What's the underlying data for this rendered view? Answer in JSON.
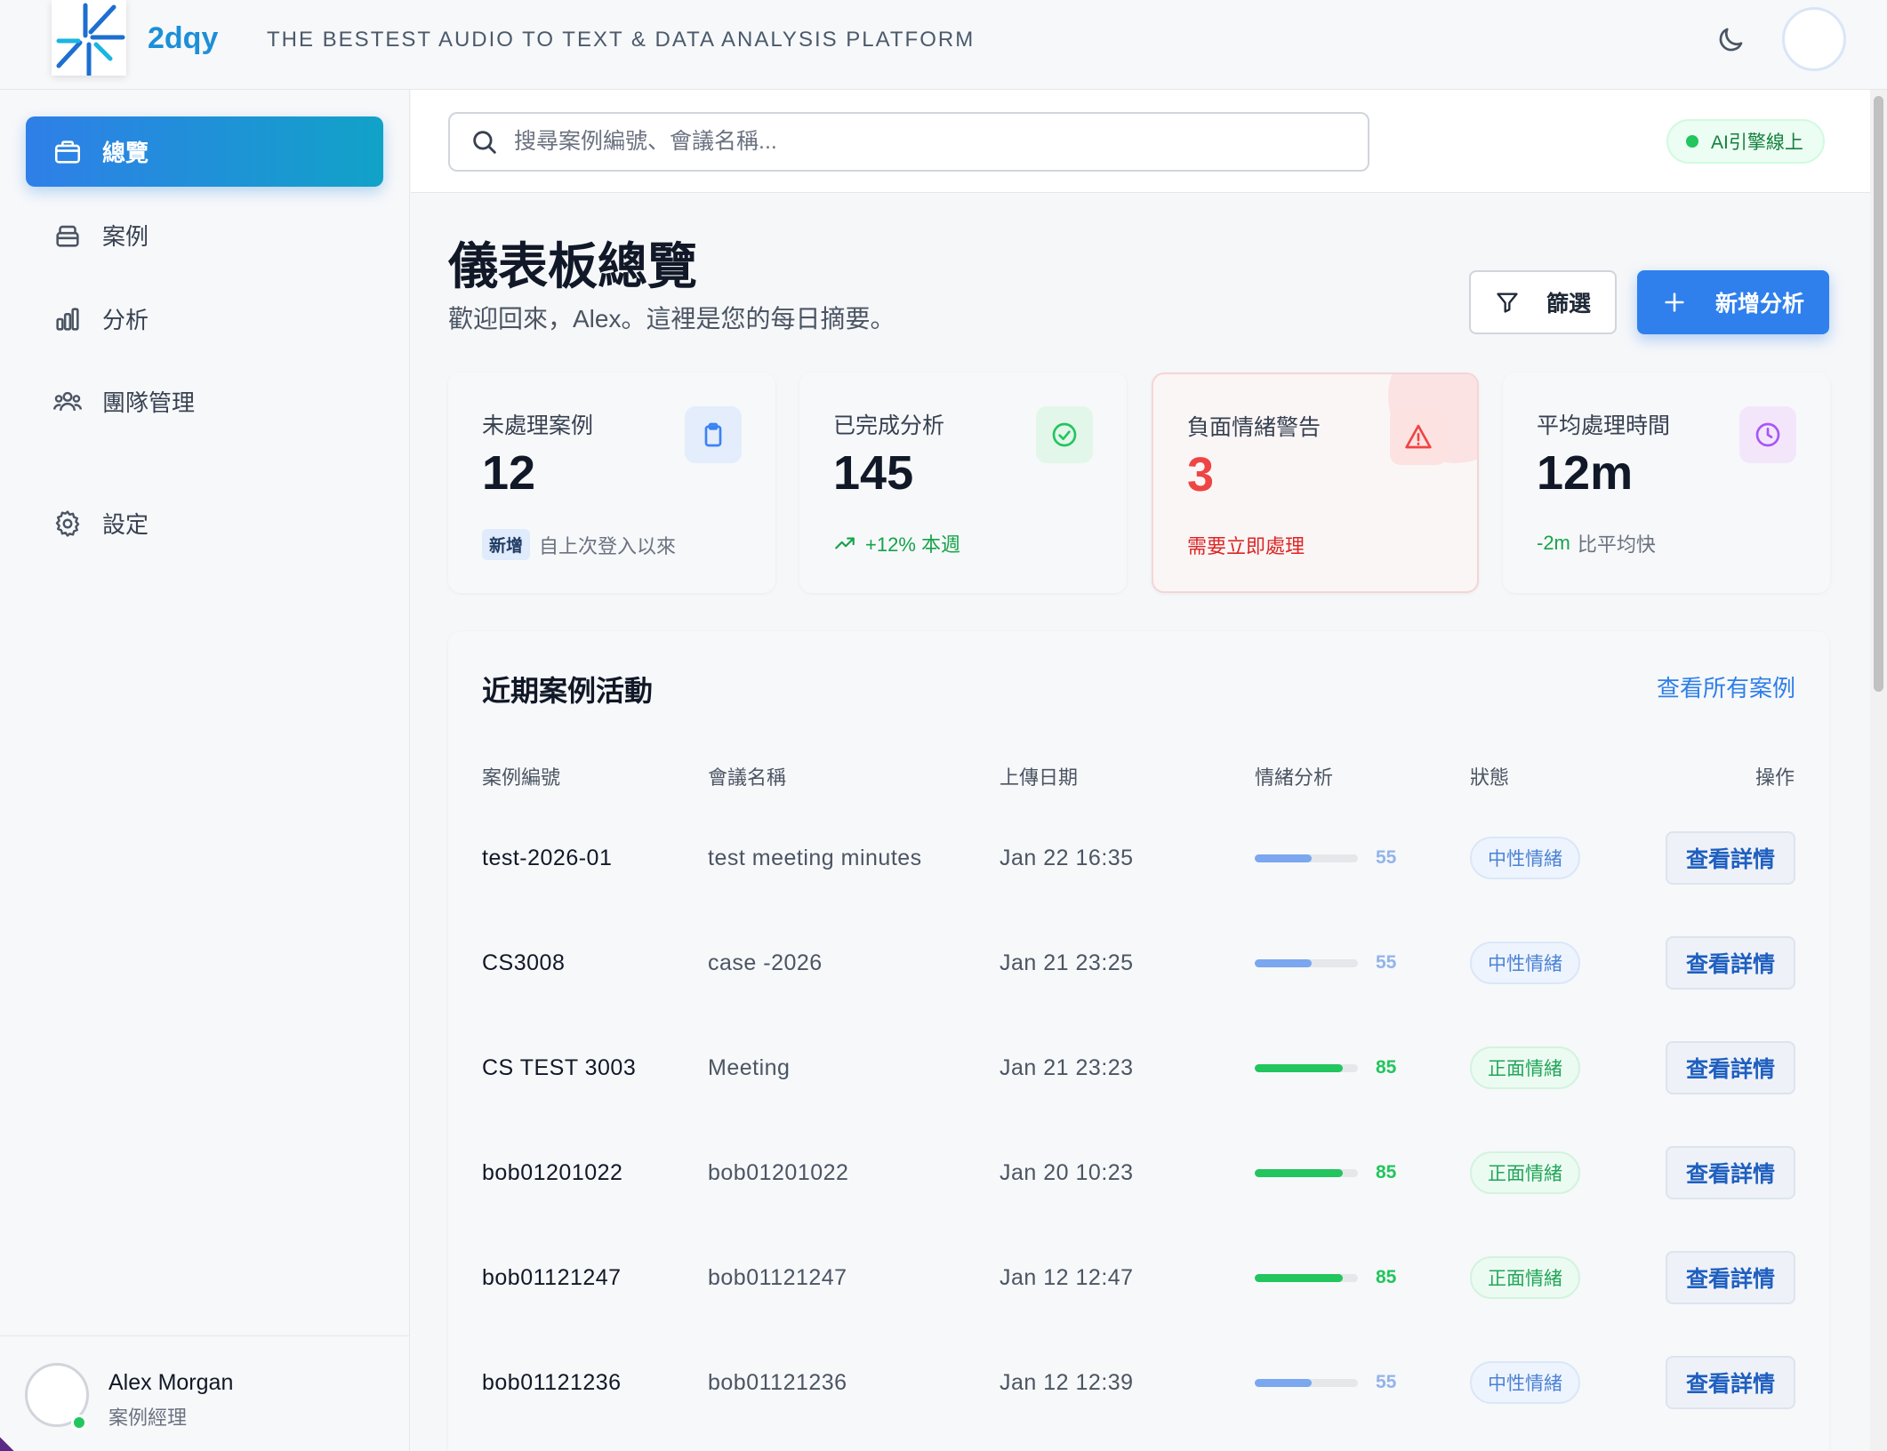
{
  "header": {
    "brand": "2dqy",
    "tagline": "THE BESTEST AUDIO TO TEXT & DATA ANALYSIS PLATFORM",
    "logo_icon": "starburst-logo",
    "theme_icon": "moon-icon"
  },
  "sidebar": {
    "items": [
      {
        "label": "總覽",
        "icon": "briefcase-icon",
        "active": true
      },
      {
        "label": "案例",
        "icon": "archive-icon",
        "active": false
      },
      {
        "label": "分析",
        "icon": "bar-chart-icon",
        "active": false
      },
      {
        "label": "團隊管理",
        "icon": "users-icon",
        "active": false
      },
      {
        "label": "設定",
        "icon": "gear-icon",
        "active": false
      }
    ],
    "user": {
      "name": "Alex Morgan",
      "role": "案例經理",
      "status": "online"
    }
  },
  "search": {
    "placeholder": "搜尋案例編號、會議名稱..."
  },
  "ai_status": "AI引擎線上",
  "page": {
    "title": "儀表板總覽",
    "subtitle": "歡迎回來，Alex。這裡是您的每日摘要。",
    "filter_label": "篩選",
    "add_label": "新增分析"
  },
  "stats": [
    {
      "label": "未處理案例",
      "value": "12",
      "badge": "新增",
      "foot": "自上次登入以來",
      "icon": "clipboard-icon",
      "color": "#3b82f6"
    },
    {
      "label": "已完成分析",
      "value": "145",
      "foot": "+12% 本週",
      "icon": "check-circle-icon",
      "color": "#22c55e"
    },
    {
      "label": "負面情緒警告",
      "value": "3",
      "foot": "需要立即處理",
      "icon": "warning-icon",
      "color": "#ef4444"
    },
    {
      "label": "平均處理時間",
      "value": "12m",
      "foot_highlight": "-2m",
      "foot": "比平均快",
      "icon": "clock-icon",
      "color": "#a855f7"
    }
  ],
  "activity": {
    "title": "近期案例活動",
    "view_all": "查看所有案例",
    "columns": [
      "案例編號",
      "會議名稱",
      "上傳日期",
      "情緒分析",
      "狀態",
      "操作"
    ],
    "rows": [
      {
        "id": "test-2026-01",
        "name": "test meeting minutes",
        "date": "Jan 22 16:35",
        "score": 55,
        "status": "中性情緒",
        "type": "neutral",
        "action": "查看詳情"
      },
      {
        "id": "CS3008",
        "name": "case -2026",
        "date": "Jan 21 23:25",
        "score": 55,
        "status": "中性情緒",
        "type": "neutral",
        "action": "查看詳情"
      },
      {
        "id": "CS TEST 3003",
        "name": "Meeting",
        "date": "Jan 21 23:23",
        "score": 85,
        "status": "正面情緒",
        "type": "positive",
        "action": "查看詳情"
      },
      {
        "id": "bob01201022",
        "name": "bob01201022",
        "date": "Jan 20 10:23",
        "score": 85,
        "status": "正面情緒",
        "type": "positive",
        "action": "查看詳情"
      },
      {
        "id": "bob01121247",
        "name": "bob01121247",
        "date": "Jan 12 12:47",
        "score": 85,
        "status": "正面情緒",
        "type": "positive",
        "action": "查看詳情"
      },
      {
        "id": "bob01121236",
        "name": "bob01121236",
        "date": "Jan 12 12:39",
        "score": 55,
        "status": "中性情緒",
        "type": "neutral",
        "action": "查看詳情"
      }
    ]
  },
  "colors": {
    "accent": "#2f80ed",
    "neutral_bar": "#7aa7ef",
    "positive_bar": "#22c55e"
  }
}
